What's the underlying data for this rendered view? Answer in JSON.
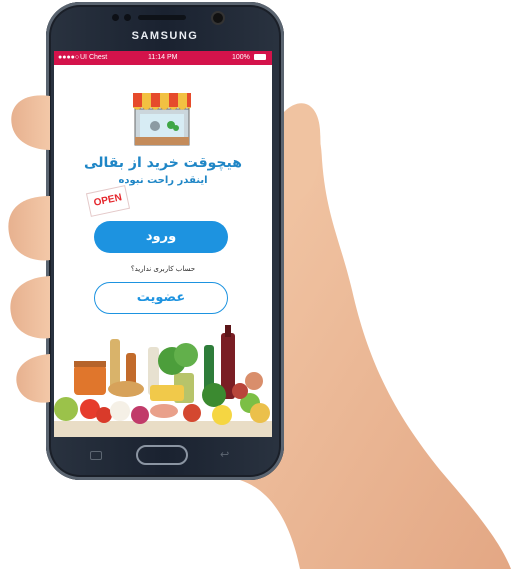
{
  "device": {
    "brand": "SAMSUNG"
  },
  "status_bar": {
    "carrier": "UI Chest",
    "time": "11:14 PM",
    "battery": "100%",
    "color": "#d4134b"
  },
  "shop_icon": "storefront-awning-icon",
  "open_sign": {
    "text": "OPEN"
  },
  "headline": {
    "line1": "هیچوقت خرید از بقالی",
    "line2": "اینقدر راحت نبوده"
  },
  "login_button": {
    "label": "ورود",
    "color": "#1d93e0"
  },
  "no_account_text": "حساب کاربری ندارید؟",
  "signup_button": {
    "label": "عضویت"
  },
  "groceries_image": "groceries-illustration",
  "nav": {
    "home": "home-button",
    "recent": "recent-apps-icon",
    "back": "back-icon"
  }
}
